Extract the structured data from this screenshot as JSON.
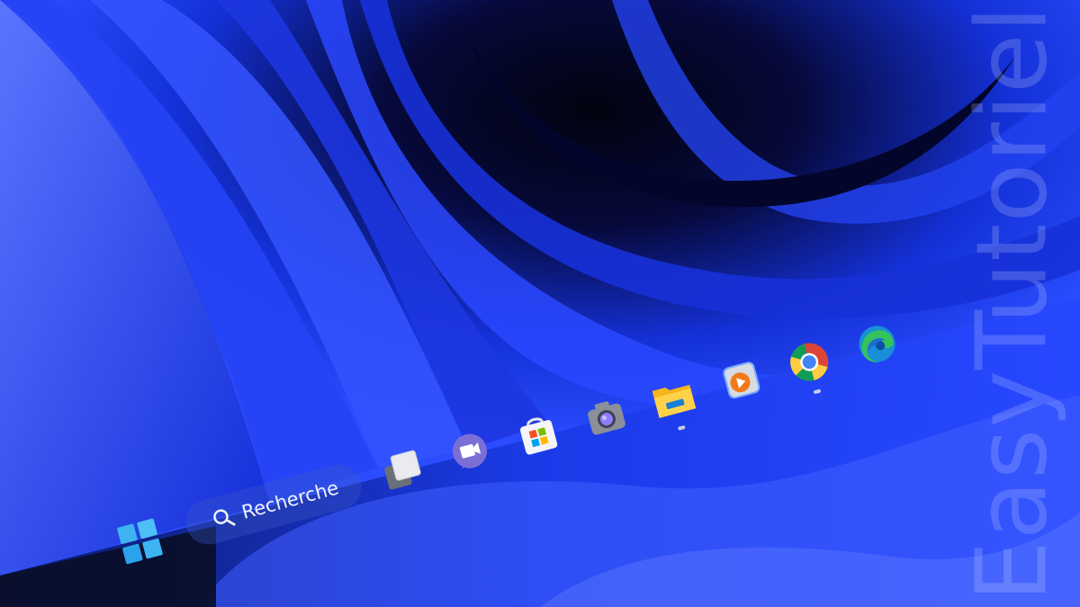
{
  "taskbar": {
    "search": {
      "label": "Recherche",
      "icon": "search-icon"
    },
    "items": [
      {
        "name": "start-button",
        "icon": "windows-logo-icon",
        "running": false
      },
      {
        "name": "task-view-button",
        "icon": "task-view-icon",
        "running": false
      },
      {
        "name": "teams-chat-button",
        "icon": "camera-chat-icon",
        "running": false
      },
      {
        "name": "microsoft-store-button",
        "icon": "store-bag-icon",
        "running": false
      },
      {
        "name": "camera-app-button",
        "icon": "camera-icon",
        "running": false
      },
      {
        "name": "file-explorer-button",
        "icon": "folder-icon",
        "running": true
      },
      {
        "name": "media-player-button",
        "icon": "media-player-icon",
        "running": false
      },
      {
        "name": "chrome-button",
        "icon": "chrome-icon",
        "running": true
      },
      {
        "name": "edge-button",
        "icon": "edge-icon",
        "running": false
      }
    ]
  },
  "watermark": {
    "text": "EasyTutoriel"
  },
  "colors": {
    "wallpaper_dark": "#05081e",
    "wallpaper_blue": "#1f3cf0",
    "wallpaper_highlight": "#4e6bff",
    "windows_blue": "#3fb3f2",
    "store_red": "#f25022",
    "store_green": "#7fba00",
    "store_blue": "#00a4ef",
    "store_yellow": "#ffb900"
  }
}
